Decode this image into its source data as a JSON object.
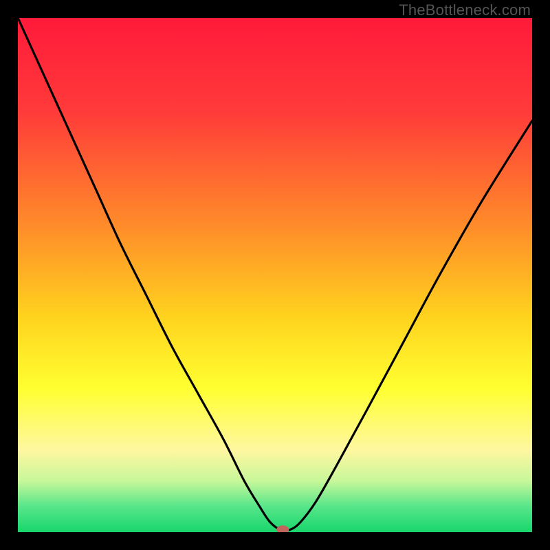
{
  "watermark": "TheBottleneck.com",
  "chart_data": {
    "type": "line",
    "title": "",
    "xlabel": "",
    "ylabel": "",
    "xlim": [
      0,
      100
    ],
    "ylim": [
      0,
      100
    ],
    "background_gradient": {
      "stops": [
        {
          "offset": 0,
          "color": "#ff1a3a"
        },
        {
          "offset": 18,
          "color": "#ff3a3a"
        },
        {
          "offset": 40,
          "color": "#ff8a2a"
        },
        {
          "offset": 58,
          "color": "#ffd21e"
        },
        {
          "offset": 72,
          "color": "#ffff30"
        },
        {
          "offset": 84,
          "color": "#fff7a0"
        },
        {
          "offset": 90,
          "color": "#c8f79a"
        },
        {
          "offset": 95,
          "color": "#57e68a"
        },
        {
          "offset": 100,
          "color": "#18d66c"
        }
      ]
    },
    "series": [
      {
        "name": "bottleneck-curve",
        "color": "#000000",
        "x": [
          0,
          5,
          10,
          15,
          20,
          25,
          30,
          35,
          40,
          44,
          47,
          49,
          51,
          53,
          55,
          58,
          62,
          68,
          75,
          82,
          90,
          100
        ],
        "y": [
          100,
          89,
          78,
          67,
          56,
          46,
          36,
          27,
          18,
          10,
          5,
          2,
          0.5,
          0.5,
          2,
          6,
          13,
          24,
          37,
          50,
          64,
          80
        ]
      }
    ],
    "marker": {
      "name": "current-point",
      "x": 51.5,
      "y": 0.5,
      "color": "#c1645c",
      "rx": 9,
      "ry": 6
    }
  }
}
